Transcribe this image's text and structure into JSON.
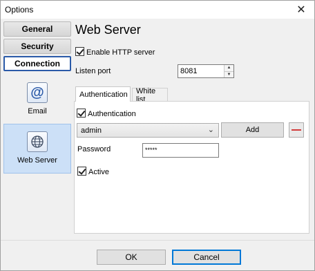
{
  "window": {
    "title": "Options"
  },
  "nav": {
    "buttons": [
      {
        "label": "General"
      },
      {
        "label": "Security"
      },
      {
        "label": "Connection"
      }
    ],
    "tiles": [
      {
        "label": "Email",
        "icon": "at-icon"
      },
      {
        "label": "Web Server",
        "icon": "globe-icon"
      }
    ]
  },
  "main": {
    "heading": "Web Server",
    "enable_http_label": "Enable HTTP server",
    "enable_http_checked": true,
    "listen_port_label": "Listen port",
    "listen_port_value": "8081",
    "tabs": [
      {
        "label": "Authentication"
      },
      {
        "label": "White list"
      }
    ],
    "auth": {
      "authentication_label": "Authentication",
      "authentication_checked": true,
      "user_select_value": "admin",
      "add_label": "Add",
      "password_label": "Password",
      "password_value": "*****",
      "active_label": "Active",
      "active_checked": true
    }
  },
  "footer": {
    "ok_label": "OK",
    "cancel_label": "Cancel"
  },
  "colors": {
    "accent": "#2a5aa8",
    "selected_tile_bg": "#cce0f7",
    "remove_red": "#d23a3a"
  }
}
